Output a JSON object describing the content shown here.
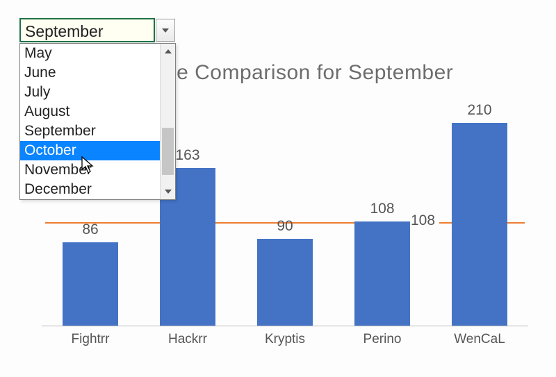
{
  "icons": {
    "caret_down": "caret-down-icon",
    "chevron_up": "chevron-up-icon",
    "chevron_down": "chevron-down-icon"
  },
  "dropdown": {
    "selected_value": "September",
    "visible_options": [
      "May",
      "June",
      "July",
      "August",
      "September",
      "October",
      "November",
      "December"
    ],
    "highlighted": "October"
  },
  "chart_data": {
    "type": "bar",
    "title": "Revenue Comparison for September",
    "categories": [
      "Fightrr",
      "Hackrr",
      "Kryptis",
      "Perino",
      "WenCaL"
    ],
    "values": [
      86,
      163,
      90,
      108,
      210
    ],
    "reference_line": {
      "label": "108",
      "value": 108
    },
    "ylim": [
      0,
      230
    ],
    "xlabel": "",
    "ylabel": "",
    "colors": {
      "bar": "#4473c5",
      "reference": "#ed7d31",
      "title": "#6d6d6d"
    }
  }
}
